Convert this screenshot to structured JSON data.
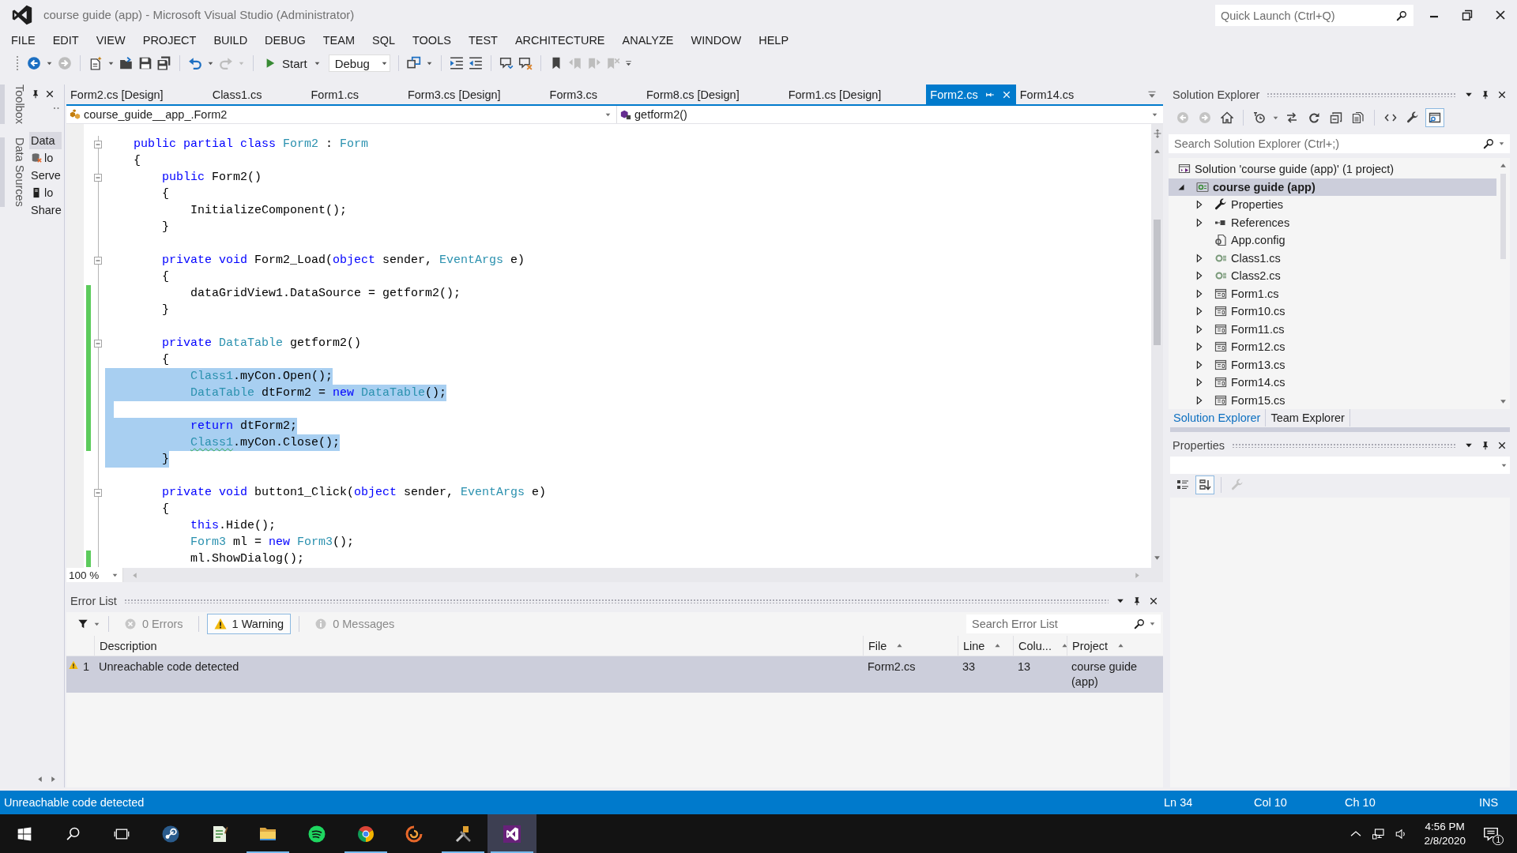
{
  "window": {
    "title": "course guide (app) - Microsoft Visual Studio (Administrator)",
    "quick_launch": {
      "placeholder": "Quick Launch (Ctrl+Q)"
    }
  },
  "menu": [
    "FILE",
    "EDIT",
    "VIEW",
    "PROJECT",
    "BUILD",
    "DEBUG",
    "TEAM",
    "SQL",
    "TOOLS",
    "TEST",
    "ARCHITECTURE",
    "ANALYZE",
    "WINDOW",
    "HELP"
  ],
  "toolbar": {
    "buttons": [
      {
        "disabled": false
      },
      {
        "disabled": true
      },
      {
        "disabled": false
      },
      {
        "disabled": false
      },
      {
        "disabled": false
      },
      {
        "disabled": false
      },
      {
        "disabled": false
      },
      {
        "disabled": true
      }
    ],
    "start": "Start",
    "configuration": "Debug",
    "more_buttons": [
      {
        "disabled": false
      },
      {
        "disabled": false
      },
      {
        "disabled": false
      },
      {
        "disabled": false
      },
      {
        "disabled": false
      },
      {
        "disabled": false
      },
      {
        "disabled": true
      },
      {
        "disabled": true
      },
      {
        "disabled": true
      }
    ]
  },
  "side_tabs": [
    "Toolbox",
    "Data Sources"
  ],
  "data_sources": {
    "items": [
      {
        "kind": "header",
        "text": "Data"
      },
      {
        "kind": "database",
        "text": "lo"
      },
      {
        "kind": "plain",
        "text": "Serve"
      },
      {
        "kind": "server",
        "text": "lo"
      },
      {
        "kind": "plain",
        "text": "Share"
      }
    ]
  },
  "editor": {
    "tabs": [
      {
        "label": "Form2.cs [Design]",
        "selected": false
      },
      {
        "label": "Class1.cs",
        "selected": false
      },
      {
        "label": "Form1.cs",
        "selected": false
      },
      {
        "label": "Form3.cs [Design]",
        "selected": false
      },
      {
        "label": "Form3.cs",
        "selected": false
      },
      {
        "label": "Form8.cs [Design]",
        "selected": false
      },
      {
        "label": "Form1.cs [Design]",
        "selected": false
      },
      {
        "label": "Form2.cs",
        "selected": true
      },
      {
        "label": "Form14.cs",
        "selected": false
      }
    ],
    "type_dropdown": "course_guide__app_.Form2",
    "member_dropdown": "getform2()",
    "lines": [
      {
        "changed": false,
        "selected": false,
        "collapsible": true,
        "tokens": [
          {
            "kind": "keyword",
            "text": "public partial class"
          },
          {
            "kind": "type",
            "text": " Form2"
          },
          {
            "kind": "plain",
            "text": " : "
          },
          {
            "kind": "type",
            "text": "Form"
          }
        ]
      },
      {
        "changed": false,
        "selected": false,
        "collapsible": false,
        "tokens": [
          {
            "kind": "plain",
            "text": "{"
          }
        ],
        "children": [
          {
            "changed": false,
            "selected": false,
            "collapsible": true,
            "tokens": [
              {
                "kind": "keyword",
                "text": "public"
              },
              {
                "kind": "plain",
                "text": " Form2()"
              }
            ]
          },
          {
            "changed": false,
            "selected": false,
            "collapsible": false,
            "tokens": [
              {
                "kind": "plain",
                "text": "{"
              }
            ],
            "children": [
              {
                "changed": false,
                "selected": false,
                "collapsible": false,
                "tokens": [
                  {
                    "kind": "plain",
                    "text": "InitializeComponent();"
                  }
                ]
              }
            ]
          },
          {
            "changed": false,
            "selected": false,
            "collapsible": false,
            "tokens": [
              {
                "kind": "plain",
                "text": "}"
              }
            ]
          },
          {
            "changed": false,
            "selected": false,
            "collapsible": false
          },
          {
            "changed": false,
            "selected": false,
            "collapsible": true,
            "tokens": [
              {
                "kind": "keyword",
                "text": "private void"
              },
              {
                "kind": "plain",
                "text": " Form2_Load("
              },
              {
                "kind": "keyword",
                "text": "object"
              },
              {
                "kind": "plain",
                "text": " sender, "
              },
              {
                "kind": "type",
                "text": "EventArgs"
              },
              {
                "kind": "plain",
                "text": " e)"
              }
            ]
          },
          {
            "changed": false,
            "selected": false,
            "collapsible": false,
            "tokens": [
              {
                "kind": "plain",
                "text": "{"
              }
            ],
            "children": [
              {
                "changed": true,
                "selected": false,
                "collapsible": false,
                "tokens": [
                  {
                    "kind": "plain",
                    "text": "dataGridView1.DataSource = getform2();"
                  }
                ]
              }
            ]
          },
          {
            "changed": true,
            "selected": false,
            "collapsible": false,
            "tokens": [
              {
                "kind": "plain",
                "text": "}"
              }
            ]
          },
          {
            "changed": true,
            "selected": false,
            "collapsible": false
          },
          {
            "changed": true,
            "selected": false,
            "collapsible": true,
            "tokens": [
              {
                "kind": "keyword",
                "text": "private"
              },
              {
                "kind": "type",
                "text": " DataTable"
              },
              {
                "kind": "plain",
                "text": " getform2()"
              }
            ]
          },
          {
            "changed": true,
            "selected": false,
            "collapsible": false,
            "tokens": [
              {
                "kind": "plain",
                "text": "{"
              }
            ],
            "children": [
              {
                "changed": true,
                "selected": true,
                "collapsible": false,
                "tokens": [
                  {
                    "kind": "type",
                    "text": "Class1"
                  },
                  {
                    "kind": "plain",
                    "text": ".myCon.Open();"
                  }
                ]
              },
              {
                "changed": true,
                "selected": true,
                "collapsible": false,
                "tokens": [
                  {
                    "kind": "type",
                    "text": "DataTable"
                  },
                  {
                    "kind": "plain",
                    "text": " dtForm2 = "
                  },
                  {
                    "kind": "keyword",
                    "text": "new"
                  },
                  {
                    "kind": "type",
                    "text": " DataTable"
                  },
                  {
                    "kind": "plain",
                    "text": "();"
                  }
                ]
              },
              {
                "changed": true,
                "selected": true,
                "collapsible": false
              },
              {
                "changed": true,
                "selected": true,
                "collapsible": false,
                "tokens": [
                  {
                    "kind": "keyword",
                    "text": "return"
                  },
                  {
                    "kind": "plain",
                    "text": " dtForm2;"
                  }
                ]
              },
              {
                "changed": true,
                "selected": true,
                "collapsible": false,
                "tokens": [
                  {
                    "kind": "warning",
                    "text": "Class1"
                  },
                  {
                    "kind": "plain",
                    "text": ".myCon.Close();"
                  }
                ]
              }
            ]
          },
          {
            "changed": false,
            "selected": true,
            "collapsible": false,
            "tokens": [
              {
                "kind": "plain",
                "text": "}"
              }
            ]
          },
          {
            "changed": false,
            "selected": false,
            "collapsible": false
          },
          {
            "changed": false,
            "selected": false,
            "collapsible": true,
            "tokens": [
              {
                "kind": "keyword",
                "text": "private void"
              },
              {
                "kind": "plain",
                "text": " button1_Click("
              },
              {
                "kind": "keyword",
                "text": "object"
              },
              {
                "kind": "plain",
                "text": " sender, "
              },
              {
                "kind": "type",
                "text": "EventArgs"
              },
              {
                "kind": "plain",
                "text": " e)"
              }
            ]
          },
          {
            "changed": false,
            "selected": false,
            "collapsible": false,
            "tokens": [
              {
                "kind": "plain",
                "text": "{"
              }
            ],
            "children": [
              {
                "changed": false,
                "selected": false,
                "collapsible": false,
                "tokens": [
                  {
                    "kind": "keyword",
                    "text": "this"
                  },
                  {
                    "kind": "plain",
                    "text": ".Hide();"
                  }
                ]
              },
              {
                "changed": false,
                "selected": false,
                "collapsible": false,
                "tokens": [
                  {
                    "kind": "type",
                    "text": "Form3"
                  },
                  {
                    "kind": "plain",
                    "text": " ml = "
                  },
                  {
                    "kind": "keyword",
                    "text": "new"
                  },
                  {
                    "kind": "type",
                    "text": " Form3"
                  },
                  {
                    "kind": "plain",
                    "text": "();"
                  }
                ]
              },
              {
                "changed": true,
                "selected": false,
                "collapsible": false,
                "tokens": [
                  {
                    "kind": "plain",
                    "text": "ml.ShowDialog();"
                  }
                ]
              }
            ]
          }
        ]
      }
    ],
    "zoom": "100 %"
  },
  "error_list": {
    "title": "Error List",
    "filters": [
      {
        "label": "0 Errors",
        "selected": false
      },
      {
        "label": "1 Warning",
        "selected": true
      },
      {
        "label": "0 Messages",
        "selected": false
      }
    ],
    "search": {
      "placeholder": "Search Error List"
    },
    "columns": [
      {
        "label": "Description",
        "sorted": false
      },
      {
        "label": "File",
        "sorted": true
      },
      {
        "label": "Line",
        "sorted": true
      },
      {
        "label": "Colu...",
        "sorted": true
      },
      {
        "label": "Project",
        "sorted": true
      }
    ],
    "rows": [
      {
        "kind": "warning",
        "number": "1",
        "description": "Unreachable code detected",
        "file": "Form2.cs",
        "line": "33",
        "column": "13",
        "project": "course guide (app)",
        "selected": true
      }
    ]
  },
  "solution_explorer": {
    "title": "Solution Explorer",
    "toolbar": [
      {
        "disabled": true,
        "selected": false
      },
      {
        "disabled": true,
        "selected": false
      },
      {
        "disabled": false,
        "selected": false
      },
      {
        "disabled": false,
        "selected": false
      },
      {
        "disabled": false,
        "selected": false
      },
      {
        "disabled": false,
        "selected": false
      },
      {
        "disabled": false,
        "selected": false
      },
      {
        "disabled": false,
        "selected": false
      },
      {
        "disabled": false,
        "selected": false
      },
      {
        "disabled": false,
        "selected": false
      },
      {
        "disabled": false,
        "selected": true
      }
    ],
    "search": {
      "placeholder": "Search Solution Explorer (Ctrl+;)"
    },
    "tree": [
      {
        "label": "Solution 'course guide (app)' (1 project)",
        "kind": "solution",
        "selected": false,
        "children": [
          {
            "label": "course guide (app)",
            "kind": "project",
            "selected": true,
            "expanded": true,
            "children": [
              {
                "label": "Properties",
                "kind": "properties",
                "selected": false,
                "expanded": false
              },
              {
                "label": "References",
                "kind": "references",
                "selected": false,
                "expanded": false
              },
              {
                "label": "App.config",
                "kind": "config",
                "selected": false
              },
              {
                "label": "Class1.cs",
                "kind": "class",
                "selected": false,
                "expanded": false
              },
              {
                "label": "Class2.cs",
                "kind": "class",
                "selected": false,
                "expanded": false
              },
              {
                "label": "Form1.cs",
                "kind": "form",
                "selected": false,
                "expanded": false
              },
              {
                "label": "Form10.cs",
                "kind": "form",
                "selected": false,
                "expanded": false
              },
              {
                "label": "Form11.cs",
                "kind": "form",
                "selected": false,
                "expanded": false
              },
              {
                "label": "Form12.cs",
                "kind": "form",
                "selected": false,
                "expanded": false
              },
              {
                "label": "Form13.cs",
                "kind": "form",
                "selected": false,
                "expanded": false
              },
              {
                "label": "Form14.cs",
                "kind": "form",
                "selected": false,
                "expanded": false
              },
              {
                "label": "Form15.cs",
                "kind": "form",
                "selected": false,
                "expanded": false
              }
            ]
          }
        ]
      }
    ],
    "tabs": [
      {
        "label": "Solution Explorer",
        "selected": true
      },
      {
        "label": "Team Explorer",
        "selected": false
      }
    ]
  },
  "properties": {
    "title": "Properties",
    "view_buttons": [
      {
        "selected": false,
        "disabled": false
      },
      {
        "selected": true,
        "disabled": false
      },
      {
        "selected": false,
        "disabled": true
      }
    ]
  },
  "status_bar": {
    "message": "Unreachable code detected",
    "line": "Ln 34",
    "column": "Col 10",
    "char": "Ch 10",
    "mode": "INS"
  },
  "taskbar": {
    "apps": [
      {
        "running": false,
        "selected": false
      },
      {
        "running": false,
        "selected": false
      },
      {
        "running": true,
        "selected": false
      },
      {
        "running": false,
        "selected": false
      },
      {
        "running": true,
        "selected": false
      },
      {
        "running": false,
        "selected": false
      },
      {
        "running": true,
        "selected": false
      },
      {
        "running": true,
        "selected": true
      }
    ],
    "clock": {
      "time": "4:56 PM",
      "date": "2/8/2020"
    },
    "notification_count": "1"
  }
}
